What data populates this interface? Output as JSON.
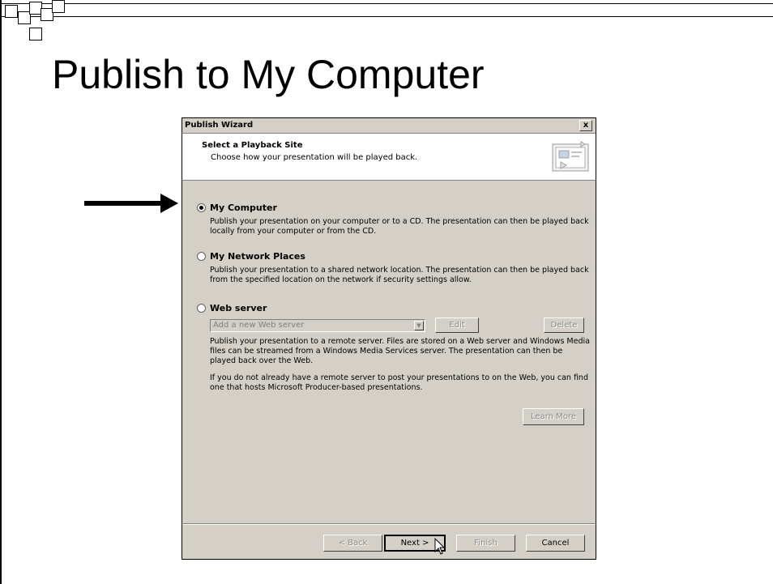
{
  "slide": {
    "title": "Publish to My Computer"
  },
  "dialog": {
    "title": "Publish Wizard",
    "close_label": "x",
    "header": {
      "title": "Select a Playback Site",
      "subtitle": "Choose how your presentation will be played back."
    },
    "options": [
      {
        "label": "My Computer",
        "selected": true,
        "description": "Publish your presentation on your computer or to a CD. The presentation can then be played back locally from your computer or from the CD."
      },
      {
        "label": "My Network Places",
        "selected": false,
        "description": "Publish your presentation to a shared network location. The presentation can then be played back from the specified location on the network if security settings allow."
      },
      {
        "label": "Web server",
        "selected": false,
        "description": "Publish your presentation to a remote server. Files are stored on a Web server and Windows Media files can be streamed from a Windows Media Services server. The presentation can then be played back over the Web.",
        "description2": "If you do not already have a remote server to post your presentations to on the Web, you can find one that hosts Microsoft Producer-based presentations."
      }
    ],
    "web_server": {
      "combo_value": "Add a new Web server",
      "edit_label": "Edit",
      "delete_label": "Delete",
      "learn_more_label": "Learn More"
    },
    "footer": {
      "back_label": "< Back",
      "next_label": "Next >",
      "finish_label": "Finish",
      "cancel_label": "Cancel"
    }
  }
}
